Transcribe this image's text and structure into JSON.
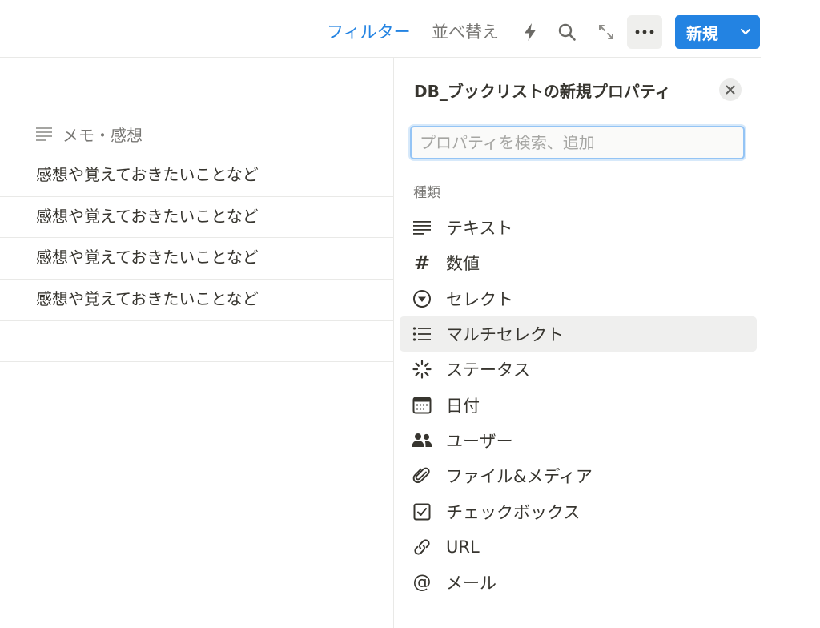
{
  "toolbar": {
    "filter_label": "フィルター",
    "sort_label": "並べ替え",
    "automation_icon": "lightning-icon",
    "search_icon": "search-icon",
    "expand_icon": "expand-icon",
    "more_icon": "more-icon",
    "new_label": "新規",
    "new_caret_icon": "chevron-down-icon"
  },
  "table": {
    "column_header": "メモ・感想",
    "column_icon": "text-lines-icon",
    "rows": [
      "感想や覚えておきたいことなど",
      "感想や覚えておきたいことなど",
      "感想や覚えておきたいことなど",
      "感想や覚えておきたいことなど"
    ]
  },
  "panel": {
    "title": "DB_ブックリストの新規プロパティ",
    "search_placeholder": "プロパティを検索、追加",
    "section_label": "種類",
    "types": [
      {
        "label": "テキスト",
        "icon": "text-lines-icon"
      },
      {
        "label": "数値",
        "icon": "hash-icon"
      },
      {
        "label": "セレクト",
        "icon": "select-icon"
      },
      {
        "label": "マルチセレクト",
        "icon": "list-icon"
      },
      {
        "label": "ステータス",
        "icon": "status-icon"
      },
      {
        "label": "日付",
        "icon": "calendar-icon"
      },
      {
        "label": "ユーザー",
        "icon": "users-icon"
      },
      {
        "label": "ファイル&メディア",
        "icon": "paperclip-icon"
      },
      {
        "label": "チェックボックス",
        "icon": "checkbox-icon"
      },
      {
        "label": "URL",
        "icon": "link-icon"
      },
      {
        "label": "メール",
        "icon": "at-icon"
      }
    ]
  },
  "colors": {
    "accent": "#2383e2",
    "text": "#37352f",
    "muted": "#787774",
    "hover": "#efefee",
    "border": "#e9e9e7"
  }
}
